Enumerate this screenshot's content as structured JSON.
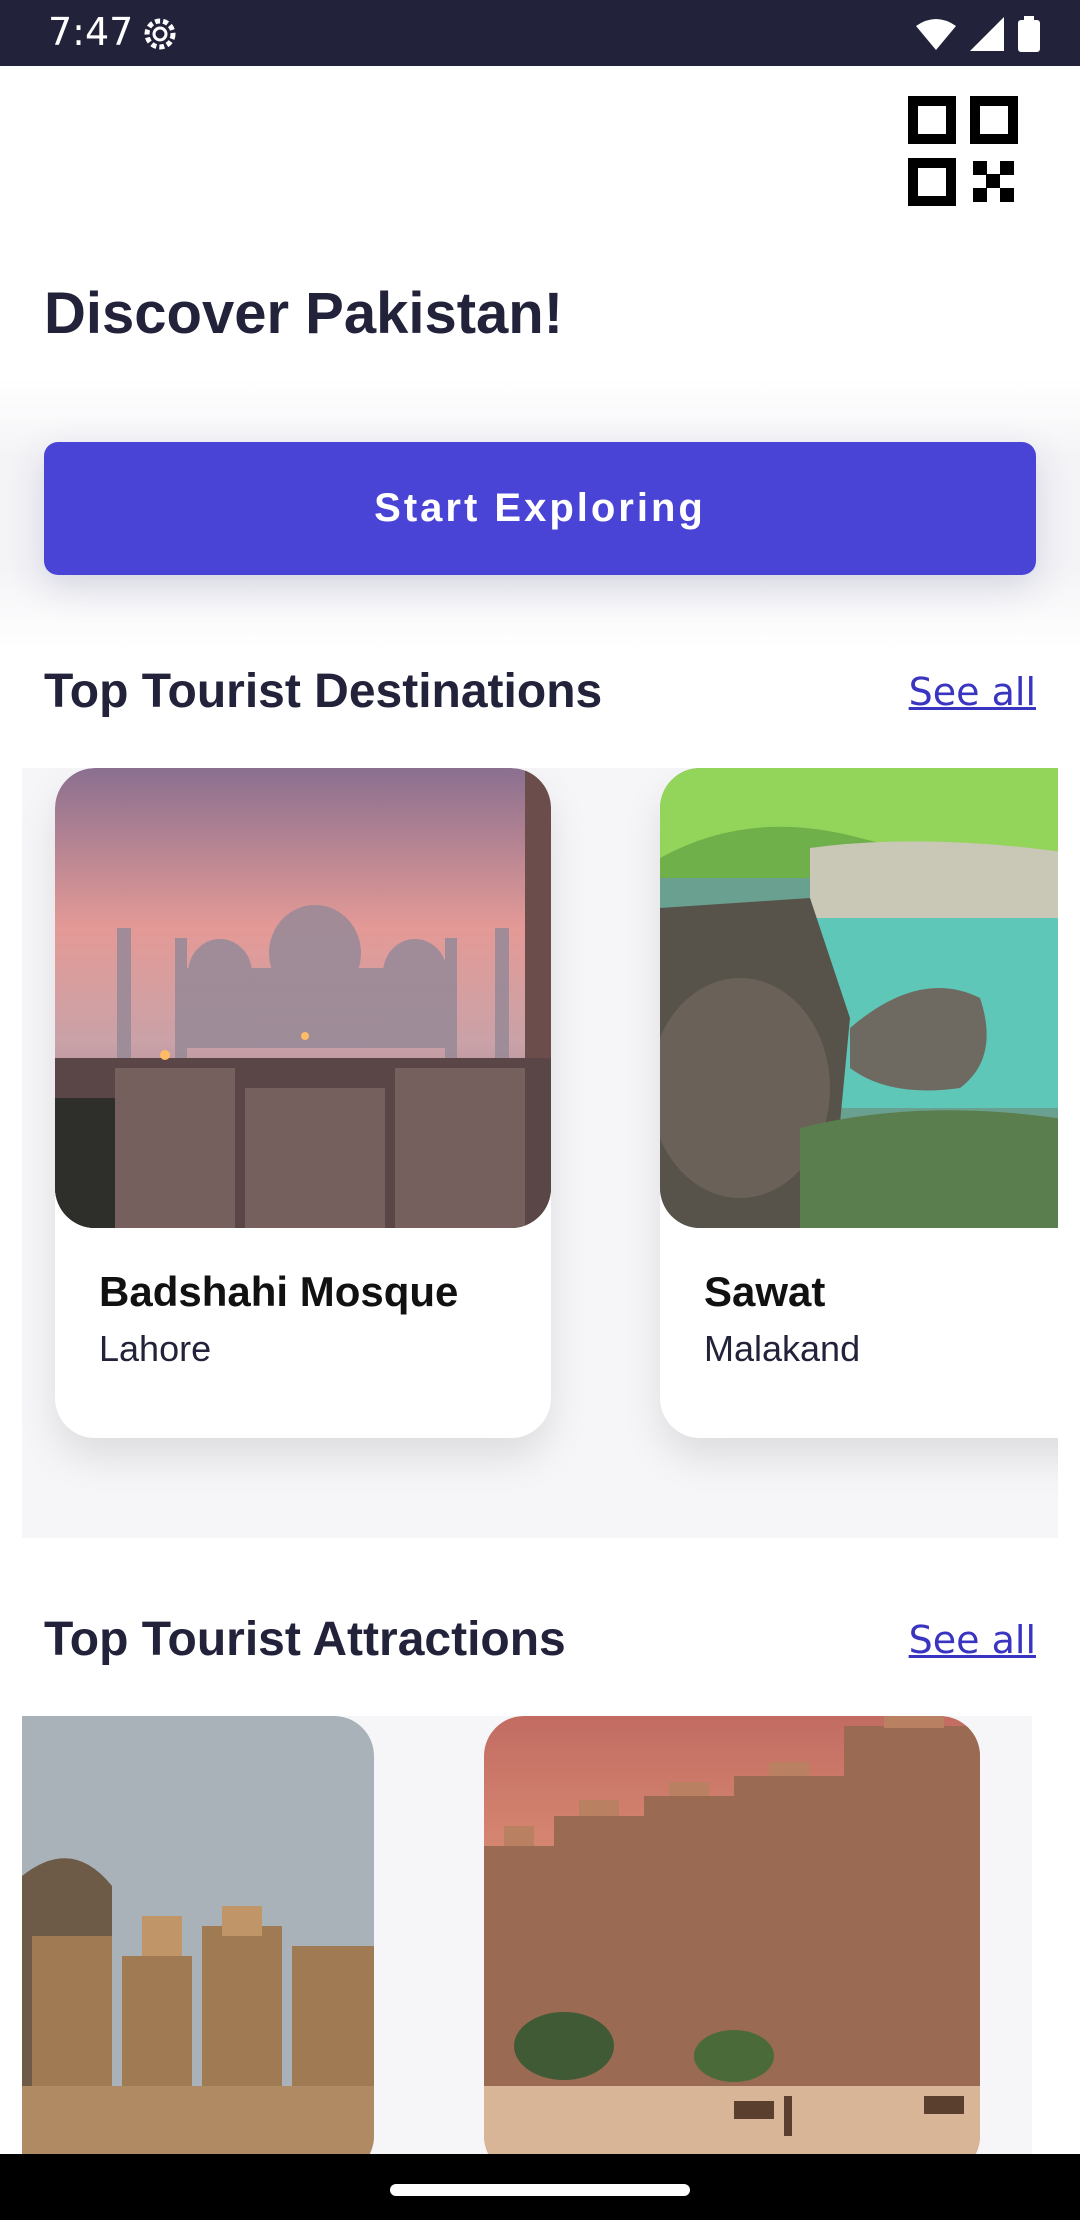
{
  "status_bar": {
    "time": "7:47"
  },
  "header": {
    "title": "Discover Pakistan!"
  },
  "cta": {
    "label": "Start Exploring"
  },
  "destinations": {
    "title": "Top Tourist Destinations",
    "see_all": "See all",
    "items": [
      {
        "name": "Badshahi Mosque",
        "location": "Lahore"
      },
      {
        "name": "Sawat",
        "location": "Malakand"
      }
    ]
  },
  "attractions": {
    "title": "Top Tourist Attractions",
    "see_all": "See all"
  },
  "colors": {
    "primary": "#4a44d6",
    "text_dark": "#22223b",
    "status_bar": "#22223b",
    "link": "#3a35c0"
  }
}
